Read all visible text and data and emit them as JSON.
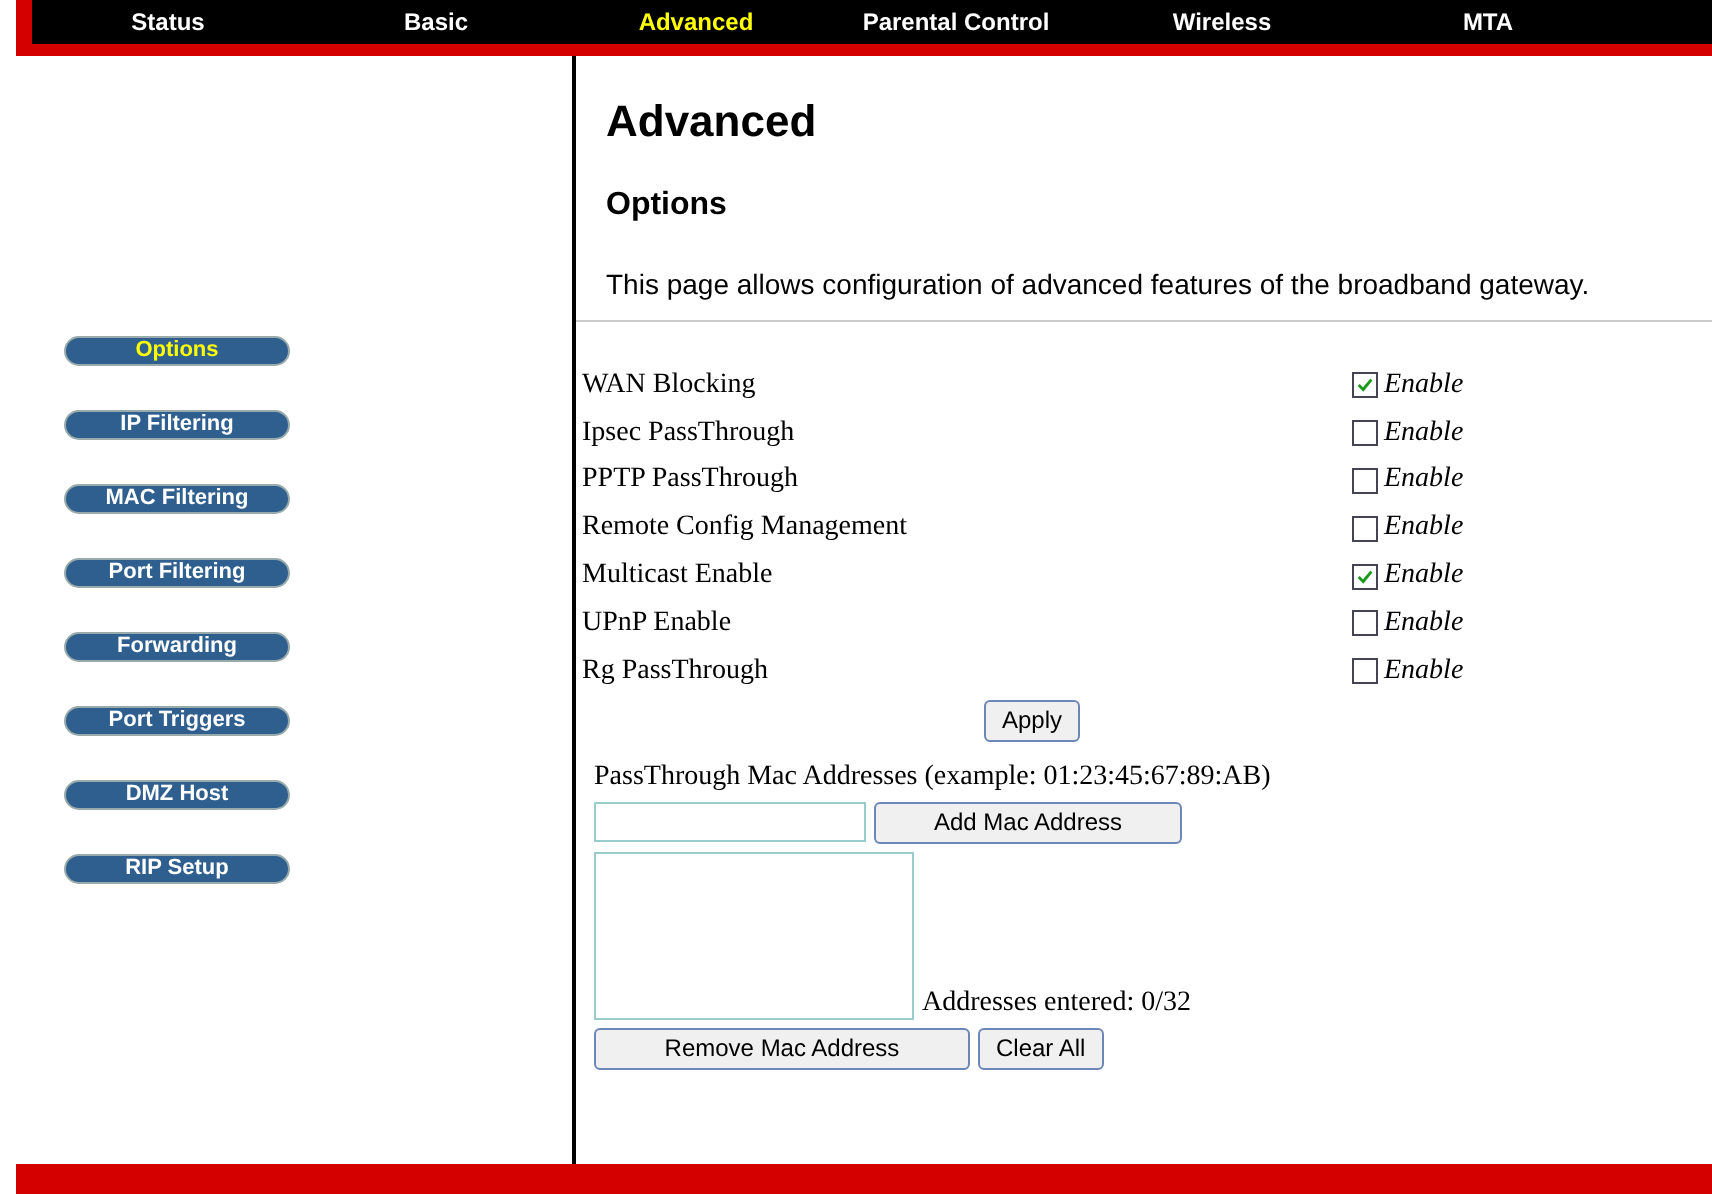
{
  "nav": [
    {
      "label": "Status",
      "selected": false
    },
    {
      "label": "Basic",
      "selected": false
    },
    {
      "label": "Advanced",
      "selected": true
    },
    {
      "label": "Parental Control",
      "selected": false
    },
    {
      "label": "Wireless",
      "selected": false
    },
    {
      "label": "MTA",
      "selected": false
    }
  ],
  "sidebar": {
    "items": [
      {
        "label": "Options",
        "selected": true
      },
      {
        "label": "IP Filtering",
        "selected": false
      },
      {
        "label": "MAC Filtering",
        "selected": false
      },
      {
        "label": "Port Filtering",
        "selected": false
      },
      {
        "label": "Forwarding",
        "selected": false
      },
      {
        "label": "Port Triggers",
        "selected": false
      },
      {
        "label": "DMZ Host",
        "selected": false
      },
      {
        "label": "RIP Setup",
        "selected": false
      }
    ]
  },
  "page": {
    "title": "Advanced",
    "subtitle": "Options",
    "description": "This page allows configuration of advanced features of the broadband gateway."
  },
  "options": [
    {
      "label": "WAN Blocking",
      "checked": true,
      "option": "Enable"
    },
    {
      "label": "Ipsec PassThrough",
      "checked": false,
      "option": "Enable"
    },
    {
      "label": "PPTP PassThrough",
      "checked": false,
      "option": "Enable"
    },
    {
      "label": "Remote Config Management",
      "checked": false,
      "option": "Enable"
    },
    {
      "label": "Multicast Enable",
      "checked": true,
      "option": "Enable"
    },
    {
      "label": "UPnP Enable",
      "checked": false,
      "option": "Enable"
    },
    {
      "label": "Rg PassThrough",
      "checked": false,
      "option": "Enable"
    }
  ],
  "apply_button": "Apply",
  "mac": {
    "label": "PassThrough Mac Addresses (example: 01:23:45:67:89:AB)",
    "add_button": "Add Mac Address",
    "count": "Addresses entered: 0/32",
    "remove_button": "Remove Mac Address",
    "clear_button": "Clear All"
  }
}
